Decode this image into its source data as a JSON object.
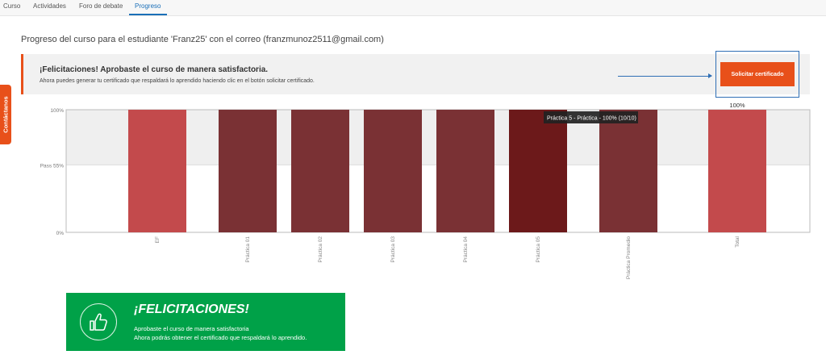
{
  "nav": {
    "tabs": [
      {
        "label": "Curso"
      },
      {
        "label": "Actividades"
      },
      {
        "label": "Foro de debate"
      },
      {
        "label": "Progreso"
      }
    ],
    "active_color": "#1a6fb8"
  },
  "side_tab": {
    "label": "Contáctanos",
    "color": "#e8501a"
  },
  "page": {
    "title": "Progreso del curso para el estudiante 'Franz25' con el correo (franzmunoz2511@gmail.com)"
  },
  "alert": {
    "title": "¡Felicitaciones! Aprobaste el curso de manera satisfactoria.",
    "subtitle": "Ahora puedes generar tu certificado que respaldará lo aprendido haciendo clic en el botón solicitar certificado.",
    "button_label": "Solicitar certificado",
    "accent": "#e8501a"
  },
  "chart_data": {
    "type": "bar",
    "categories": [
      "EF",
      "Práctica 01",
      "Práctica 02",
      "Práctica 03",
      "Práctica 04",
      "Práctica 05",
      "Práctica Promedio",
      "Total"
    ],
    "values": [
      100,
      100,
      100,
      100,
      100,
      100,
      100,
      100
    ],
    "colors": [
      "#c34a4c",
      "#7a3134",
      "#7a3134",
      "#7a3134",
      "#7a3134",
      "#6c191a",
      "#7a3134",
      "#c34a4c"
    ],
    "ylim": [
      0,
      100
    ],
    "yticks": [
      "0%",
      "Pass 55%",
      "100%"
    ],
    "pass_threshold": 55,
    "total_label": "100%",
    "tooltip": "Práctica 5 - Práctica - 100% (10/10)",
    "grid": false
  },
  "banner": {
    "title": "¡FELICITACIONES!",
    "line1": "Aprobaste el curso de manera satisfactoria",
    "line2": "Ahora podrás obtener el certificado que respaldará lo aprendido.",
    "icon": "thumbs-up-icon",
    "color": "#00a148"
  }
}
